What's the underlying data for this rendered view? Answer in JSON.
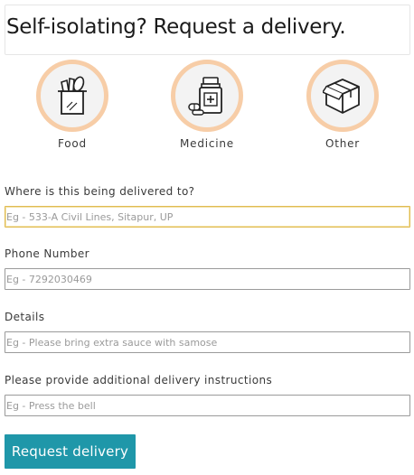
{
  "header": {
    "title": "Self-isolating? Request a delivery."
  },
  "categories": [
    {
      "label": "Food",
      "icon": "grocery-bag-icon"
    },
    {
      "label": "Medicine",
      "icon": "medicine-bottle-icon"
    },
    {
      "label": "Other",
      "icon": "package-box-icon"
    }
  ],
  "form": {
    "address": {
      "label": "Where is this being delivered to?",
      "placeholder": "Eg - 533-A Civil Lines, Sitapur, UP",
      "value": ""
    },
    "phone": {
      "label": "Phone Number",
      "placeholder": "Eg - 7292030469",
      "value": ""
    },
    "details": {
      "label": "Details",
      "placeholder": "Eg - Please bring extra sauce with samose",
      "value": ""
    },
    "instructions": {
      "label": "Please provide additional delivery instructions",
      "placeholder": "Eg - Press the bell",
      "value": ""
    },
    "submit_label": "Request delivery"
  },
  "colors": {
    "accent_button": "#1f97a9",
    "circle_ring": "#f7cda7",
    "focus_border": "#e0bb53"
  }
}
